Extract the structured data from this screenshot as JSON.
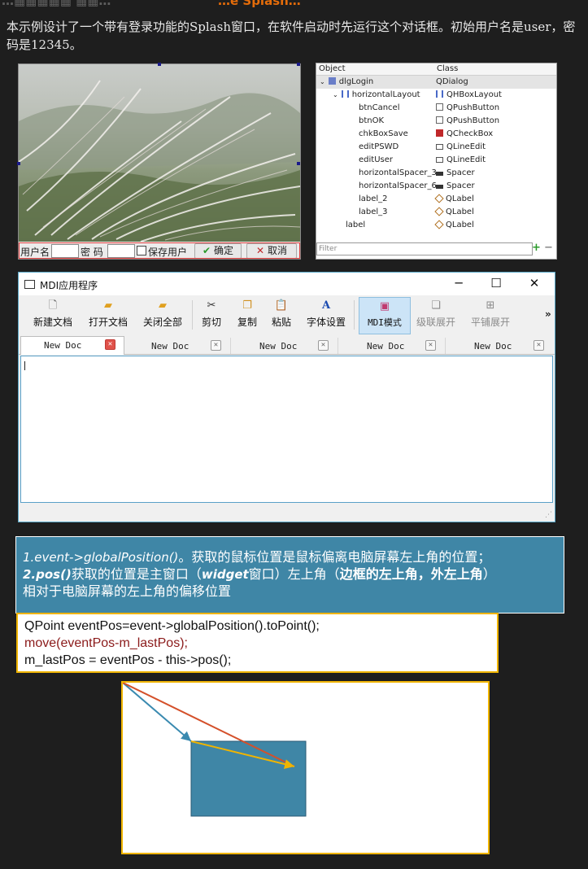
{
  "heading": {
    "left": "…▦▦▦▦▦ ▦▦…",
    "right": "…e Splash…"
  },
  "intro": "本示例设计了一个带有登录功能的Splash窗口，在软件启动时先运行这个对话框。初始用户名是user，密码是12345。",
  "login_form": {
    "user_label": "用户名",
    "pswd_label": "密 码",
    "save_label": "保存用户",
    "ok_label": "确定",
    "cancel_label": "取消"
  },
  "inspector": {
    "col_object": "Object",
    "col_class": "Class",
    "rows": [
      {
        "name": "dlgLogin",
        "class": "QDialog"
      },
      {
        "name": "horizontalLayout",
        "class": "QHBoxLayout"
      },
      {
        "name": "btnCancel",
        "class": "QPushButton"
      },
      {
        "name": "btnOK",
        "class": "QPushButton"
      },
      {
        "name": "chkBoxSave",
        "class": "QCheckBox"
      },
      {
        "name": "editPSWD",
        "class": "QLineEdit"
      },
      {
        "name": "editUser",
        "class": "QLineEdit"
      },
      {
        "name": "horizontalSpacer_3",
        "class": "Spacer"
      },
      {
        "name": "horizontalSpacer_6",
        "class": "Spacer"
      },
      {
        "name": "label_2",
        "class": "QLabel"
      },
      {
        "name": "label_3",
        "class": "QLabel"
      },
      {
        "name": "label",
        "class": "QLabel"
      }
    ],
    "filter_placeholder": "Filter",
    "add": "+",
    "remove": "−"
  },
  "mdi": {
    "title": "MDI应用程序",
    "win_min": "─",
    "win_max": "☐",
    "win_close": "✕",
    "toolbar": [
      {
        "label": "新建文档",
        "icon": "new-doc-icon"
      },
      {
        "label": "打开文档",
        "icon": "open-folder-icon"
      },
      {
        "label": "关闭全部",
        "icon": "close-all-icon"
      },
      {
        "label": "剪切",
        "icon": "scissors-icon"
      },
      {
        "label": "复制",
        "icon": "copy-icon"
      },
      {
        "label": "粘贴",
        "icon": "paste-icon"
      },
      {
        "label": "字体设置",
        "icon": "font-icon"
      },
      {
        "label": "MDI模式",
        "icon": "mdi-icon",
        "active": true
      },
      {
        "label": "级联展开",
        "icon": "cascade-icon",
        "disabled": true
      },
      {
        "label": "平铺展开",
        "icon": "tile-icon",
        "disabled": true
      }
    ],
    "overflow": "»",
    "tabs": [
      "New Doc",
      "New Doc",
      "New Doc",
      "New Doc",
      "New Doc"
    ]
  },
  "explain": {
    "l1a": "1.event->globalPosition()",
    "l1b": "。获取的鼠标位置是鼠标偏离电脑屏幕左上角的位置；",
    "l2a": "2.pos()",
    "l2b": "获取的位置是主窗口（",
    "l2c": "widget",
    "l2d": "窗口）左上角（",
    "l2e": "边框的左上角，外左上角",
    "l2f": "）",
    "l3": "相对于电脑屏幕的左上角的偏移位置"
  },
  "code": [
    "QPoint eventPos=event->globalPosition().toPoint();",
    "move(eventPos-m_lastPos);",
    "m_lastPos = eventPos - this->pos();"
  ],
  "colors": {
    "accent_orange": "#e46c0a",
    "explain_bg": "#3f86a6",
    "code_border": "#f0b400",
    "code_red": "#8b1a1a",
    "arrow_blue": "#3a8ab0",
    "arrow_red": "#d4502a",
    "arrow_yellow": "#f0b400",
    "window_fill": "#3f86a6"
  }
}
